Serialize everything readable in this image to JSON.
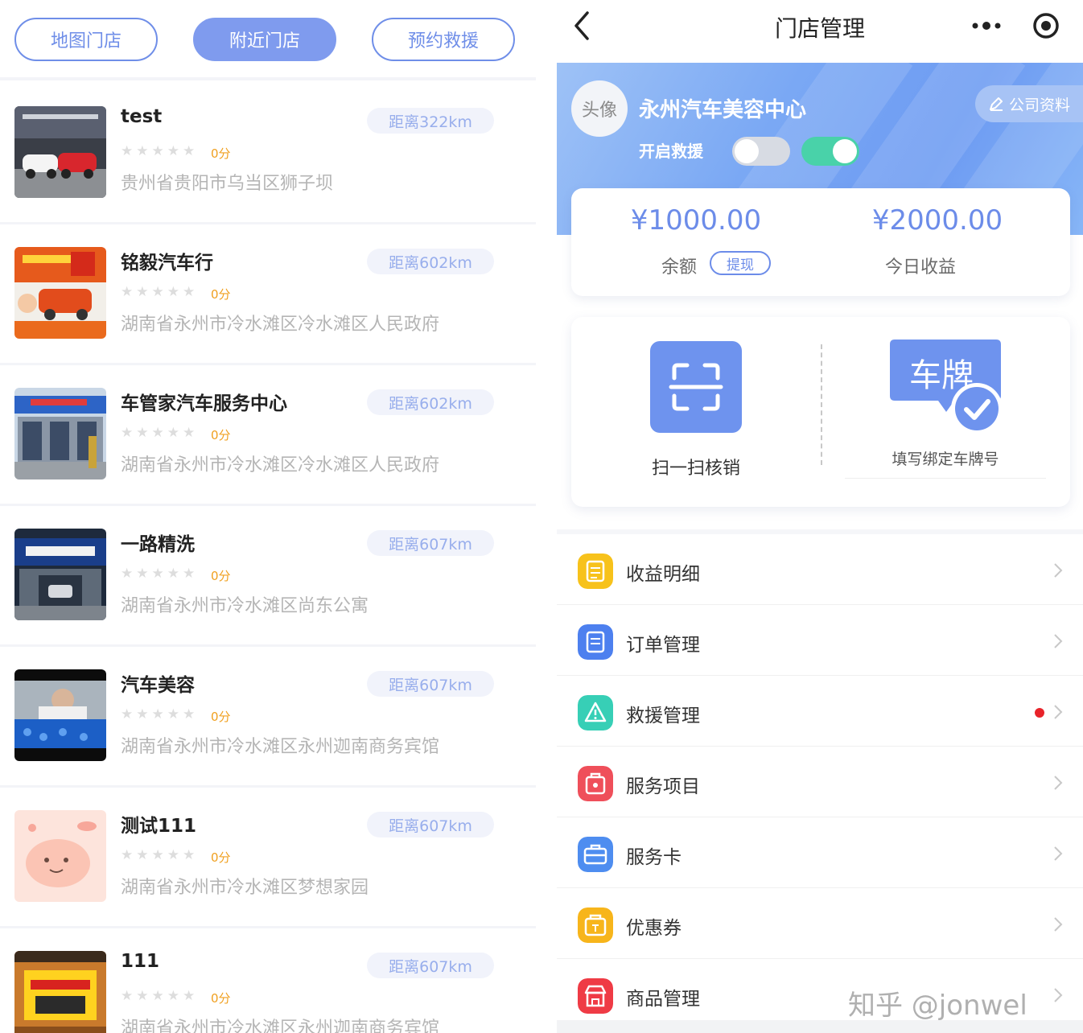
{
  "left": {
    "tabs": [
      {
        "label": "地图门店",
        "active": false
      },
      {
        "label": "附近门店",
        "active": true
      },
      {
        "label": "预约救援",
        "active": false
      }
    ],
    "stores": [
      {
        "name": "test",
        "distance": "距离322km",
        "stars": "★★★★★",
        "score": "0分",
        "address": "贵州省贵阳市乌当区狮子坝",
        "rating": 0
      },
      {
        "name": "铭毅汽车行",
        "distance": "距离602km",
        "stars": "★★★★★",
        "score": "0分",
        "address": "湖南省永州市冷水滩区冷水滩区人民政府",
        "rating": 0
      },
      {
        "name": "车管家汽车服务中心",
        "distance": "距离602km",
        "stars": "★★★★★",
        "score": "0分",
        "address": "湖南省永州市冷水滩区冷水滩区人民政府",
        "rating": 0
      },
      {
        "name": "一路精洗",
        "distance": "距离607km",
        "stars": "★★★★★",
        "score": "0分",
        "address": "湖南省永州市冷水滩区尚东公寓",
        "rating": 0
      },
      {
        "name": "汽车美容",
        "distance": "距离607km",
        "stars": "★★★★★",
        "score": "0分",
        "address": "湖南省永州市冷水滩区永州迦南商务宾馆",
        "rating": 0
      },
      {
        "name": "测试111",
        "distance": "距离607km",
        "stars": "★★★★★",
        "score": "0分",
        "address": "湖南省永州市冷水滩区梦想家园",
        "rating": 0
      },
      {
        "name": "111",
        "distance": "距离607km",
        "stars": "★★★★★",
        "score": "0分",
        "address": "湖南省永州市冷水滩区永州迦南商务宾馆",
        "rating": 0
      }
    ]
  },
  "right": {
    "nav": {
      "title": "门店管理",
      "back_icon": "chevron-left-icon",
      "more_icon": "more-dots-icon",
      "target_icon": "record-icon"
    },
    "banner": {
      "avatar": "头像",
      "shop_name": "永州汽车美容中心",
      "rescue_label": "开启救援",
      "company_button": "公司资料",
      "toggle_off": false,
      "toggle_on": true
    },
    "money": {
      "balance": "¥1000.00",
      "balance_label": "余额",
      "withdraw": "提现",
      "today": "¥2000.00",
      "today_label": "今日收益"
    },
    "actions": {
      "scan_label": "扫一扫核销",
      "plate_text": "车牌",
      "plate_label": "填写绑定车牌号"
    },
    "menu": [
      {
        "label": "收益明细",
        "icon": "ledger-icon",
        "color": "#f7c21b"
      },
      {
        "label": "订单管理",
        "icon": "clipboard-icon",
        "color": "#4d80ef"
      },
      {
        "label": "救援管理",
        "icon": "warning-icon",
        "color": "#37cfb6",
        "badge": true
      },
      {
        "label": "服务项目",
        "icon": "service-bag-icon",
        "color": "#ef4f5a"
      },
      {
        "label": "服务卡",
        "icon": "card-case-icon",
        "color": "#4e8df0"
      },
      {
        "label": "优惠券",
        "icon": "coupon-icon",
        "color": "#f7b51b"
      },
      {
        "label": "商品管理",
        "icon": "shop-icon",
        "color": "#ef3b45"
      }
    ],
    "watermark": "知乎 @jonwel"
  }
}
